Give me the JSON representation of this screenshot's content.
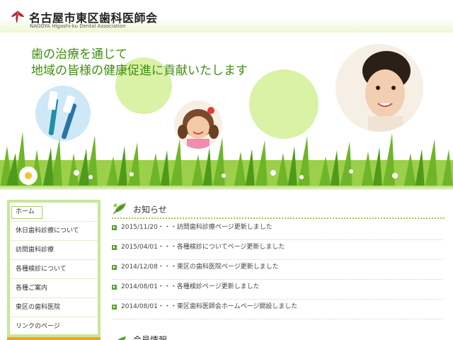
{
  "header": {
    "title": "名古屋市東区歯科医師会",
    "subtitle": "NAGOYA Higashi-ku Dental Association"
  },
  "hero": {
    "catch_line1": "歯の治療を通じて",
    "catch_line2": "地域の皆様の健康促進に貢献いたします"
  },
  "nav": {
    "items": [
      {
        "label": "ホーム",
        "active": true
      },
      {
        "label": "休日歯科診療について"
      },
      {
        "label": "訪問歯科診療"
      },
      {
        "label": "各種検診について"
      },
      {
        "label": "各種ご案内"
      },
      {
        "label": "東区の歯科医院"
      },
      {
        "label": "リンクのページ"
      }
    ]
  },
  "news": {
    "title": "お知らせ",
    "items": [
      {
        "text": "2015/11/20・・・訪問歯科診療ページ更新しました"
      },
      {
        "text": "2015/04/01・・・各種検診についてページ更新しました"
      },
      {
        "text": "2014/12/08・・・東区の歯科医院ページ更新しました"
      },
      {
        "text": "2014/08/01・・・各種検診ページ更新しました"
      },
      {
        "text": "2014/08/01・・・東区歯科医師会ホームページ開設しました"
      }
    ]
  },
  "next_section": {
    "title": "会員情報"
  },
  "colors": {
    "accent_green": "#3f8d12",
    "sidebar_border": "#c7e79a",
    "orange": "#f5a21b"
  }
}
